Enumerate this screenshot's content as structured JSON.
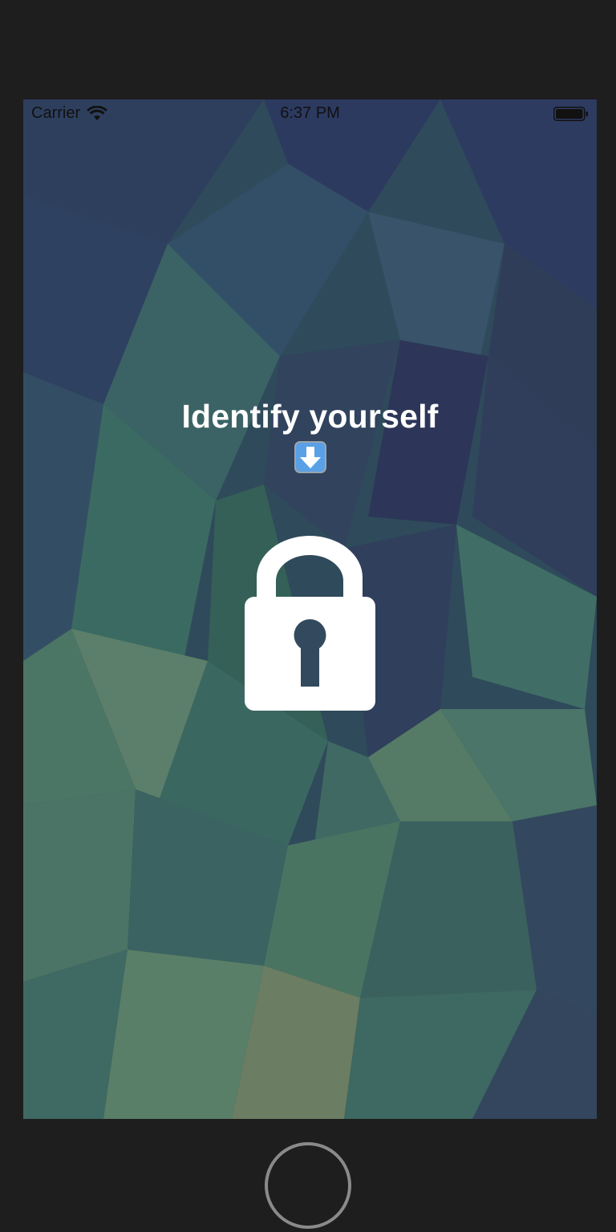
{
  "status_bar": {
    "carrier": "Carrier",
    "time": "6:37 PM"
  },
  "main": {
    "prompt": "Identify yourself"
  },
  "icons": {
    "wifi": "wifi-icon",
    "battery": "battery-icon",
    "down_arrow": "down-arrow-emoji-icon",
    "lock": "padlock-icon",
    "home": "home-button"
  }
}
